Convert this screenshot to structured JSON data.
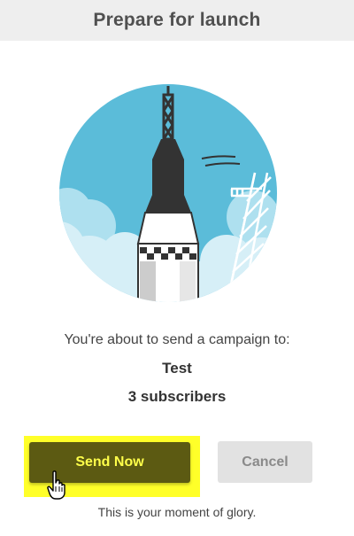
{
  "header": {
    "title": "Prepare for launch"
  },
  "illustration": {
    "icon": "rocket-launch-illustration",
    "colors": {
      "sky": "#5bbcd9",
      "rocket_body": "#ffffff",
      "rocket_nose": "#333333"
    }
  },
  "campaign": {
    "message": "You're about to send a campaign to:",
    "list_name": "Test",
    "subscribers": "3 subscribers"
  },
  "actions": {
    "send_label": "Send Now",
    "cancel_label": "Cancel",
    "send_color": "#5c5a12",
    "highlight_color": "#ffff29"
  },
  "footer": {
    "tagline": "This is your moment of glory."
  }
}
